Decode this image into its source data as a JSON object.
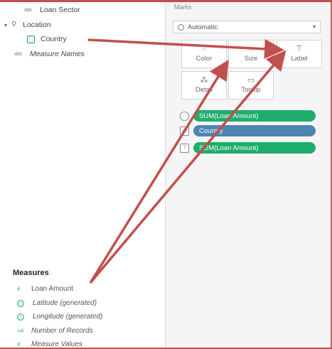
{
  "data_pane": {
    "dimensions": [
      {
        "type": "Abc",
        "label": "Loan Sector"
      },
      {
        "type": "hier",
        "label": "Location"
      },
      {
        "type": "geo",
        "label": "Country"
      },
      {
        "type": "Abc",
        "label": "Measure Names"
      }
    ],
    "measures_title": "Measures",
    "measures": [
      {
        "label": "Loan Amount",
        "italic": false
      },
      {
        "label": "Latitude (generated)",
        "italic": true
      },
      {
        "label": "Longitude (generated)",
        "italic": true
      },
      {
        "label": "Number of Records",
        "italic": true
      },
      {
        "label": "Measure Values",
        "italic": true
      }
    ]
  },
  "marks": {
    "title": "Marks",
    "mark_type": "Automatic",
    "cards": [
      {
        "label": "Color",
        "icon": "color-icon"
      },
      {
        "label": "Size",
        "icon": "size-icon"
      },
      {
        "label": "Label",
        "icon": "label-icon"
      },
      {
        "label": "Detail",
        "icon": "detail-icon"
      },
      {
        "label": "Tooltip",
        "icon": "tooltip-icon"
      }
    ],
    "pills": [
      {
        "label": "SUM(Loan Amount)",
        "color": "#1fad6b",
        "icon": "size-icon"
      },
      {
        "label": "Country",
        "color": "#4e86b1",
        "icon": "detail-icon"
      },
      {
        "label": "SUM(Loan Amount)",
        "color": "#1fad6b",
        "icon": "label-icon"
      }
    ]
  },
  "colors": {
    "annotation_arrow": "#c0504d",
    "measure_green": "#1fad6b",
    "dimension_blue": "#4e86b1"
  }
}
